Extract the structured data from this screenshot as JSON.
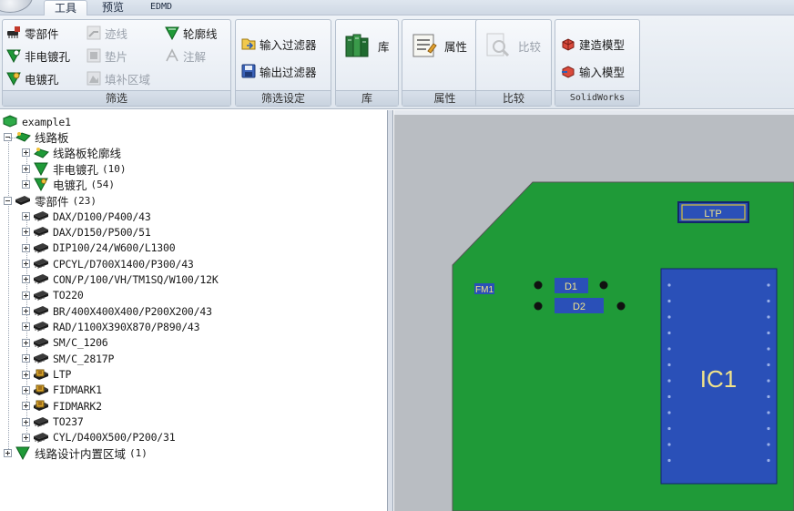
{
  "tabs": [
    {
      "label": "工具",
      "active": true
    },
    {
      "label": "预览",
      "active": false
    },
    {
      "label": "EDMD",
      "active": false
    }
  ],
  "ribbon": {
    "filter": {
      "label": "筛选",
      "items": [
        {
          "label": "零部件",
          "icon": "component-icon",
          "disabled": false
        },
        {
          "label": "迹线",
          "icon": "trace-icon",
          "disabled": true
        },
        {
          "label": "轮廓线",
          "icon": "outline-icon",
          "disabled": false
        },
        {
          "label": "非电镀孔",
          "icon": "non-plated-hole-icon",
          "disabled": false
        },
        {
          "label": "垫片",
          "icon": "pad-icon",
          "disabled": true
        },
        {
          "label": "注解",
          "icon": "annotation-icon",
          "disabled": true
        },
        {
          "label": "电镀孔",
          "icon": "plated-hole-icon",
          "disabled": false
        },
        {
          "label": "填补区域",
          "icon": "fill-area-icon",
          "disabled": true
        }
      ]
    },
    "filter_settings": {
      "label": "筛选设定",
      "items": [
        {
          "label": "输入过滤器",
          "icon": "import-filter-icon"
        },
        {
          "label": "输出过滤器",
          "icon": "export-filter-icon"
        }
      ]
    },
    "library": {
      "label": "库",
      "button": "库"
    },
    "properties": {
      "label": "属性",
      "button": "属性"
    },
    "compare": {
      "label": "比较",
      "button": "比较"
    },
    "solidworks": {
      "label": "SolidWorks",
      "items": [
        {
          "label": "建造模型",
          "icon": "build-model-icon"
        },
        {
          "label": "输入模型",
          "icon": "import-model-icon"
        }
      ]
    }
  },
  "tree": {
    "root": "example1",
    "board": {
      "label": "线路板",
      "children": [
        {
          "label": "线路板轮廓线",
          "count": ""
        },
        {
          "label": "非电镀孔",
          "count": "(10)"
        },
        {
          "label": "电镀孔",
          "count": "(54)"
        }
      ]
    },
    "components": {
      "label": "零部件",
      "count": "(23)",
      "children": [
        {
          "label": "DAX/D100/P400/43",
          "icon": "chip"
        },
        {
          "label": "DAX/D150/P500/51",
          "icon": "chip"
        },
        {
          "label": "DIP100/24/W600/L1300",
          "icon": "chip"
        },
        {
          "label": "CPCYL/D700X1400/P300/43",
          "icon": "chip"
        },
        {
          "label": "CON/P/100/VH/TM1SQ/W100/12K",
          "icon": "chip"
        },
        {
          "label": "TO220",
          "icon": "chip"
        },
        {
          "label": "BR/400X400X400/P200X200/43",
          "icon": "chip"
        },
        {
          "label": "RAD/1100X390X870/P890/43",
          "icon": "chip"
        },
        {
          "label": "SM/C_1206",
          "icon": "chip"
        },
        {
          "label": "SM/C_2817P",
          "icon": "chip"
        },
        {
          "label": "LTP",
          "icon": "fid"
        },
        {
          "label": "FIDMARK1",
          "icon": "fid"
        },
        {
          "label": "FIDMARK2",
          "icon": "fid"
        },
        {
          "label": "TO237",
          "icon": "chip"
        },
        {
          "label": "CYL/D400X500/P200/31",
          "icon": "chip"
        }
      ]
    },
    "keepin": {
      "label": "线路设计内置区域",
      "count": "(1)"
    }
  },
  "canvas": {
    "board_color": "#1f9a38",
    "refdes": {
      "ltp": "LTP",
      "fm1": "FM1",
      "d1": "D1",
      "d2": "D2",
      "ic1": "IC1"
    }
  }
}
